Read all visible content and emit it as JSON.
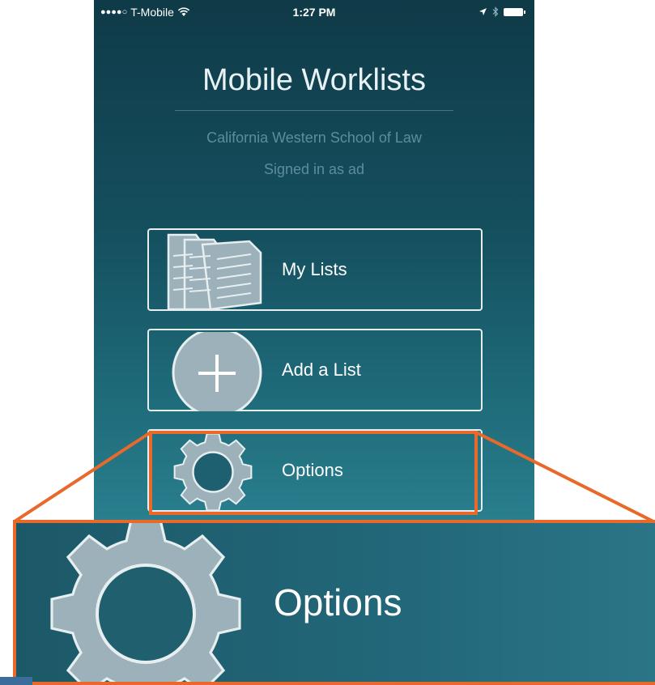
{
  "status_bar": {
    "signal": "●●●●○",
    "carrier": "T-Mobile",
    "time": "1:27 PM"
  },
  "app": {
    "title": "Mobile Worklists",
    "school": "California Western School of Law",
    "signed_in": "Signed in as ad"
  },
  "menu": {
    "my_lists": "My Lists",
    "add_list": "Add a List",
    "options": "Options"
  },
  "zoom": {
    "options": "Options"
  },
  "colors": {
    "highlight": "#e8692a",
    "background_top": "#0f3a48",
    "background_bottom": "#2a7f8e",
    "icon_fill": "#9cb1ba"
  },
  "icons": {
    "my_lists": "documents-icon",
    "add_list": "plus-circle-icon",
    "options": "gear-icon"
  }
}
